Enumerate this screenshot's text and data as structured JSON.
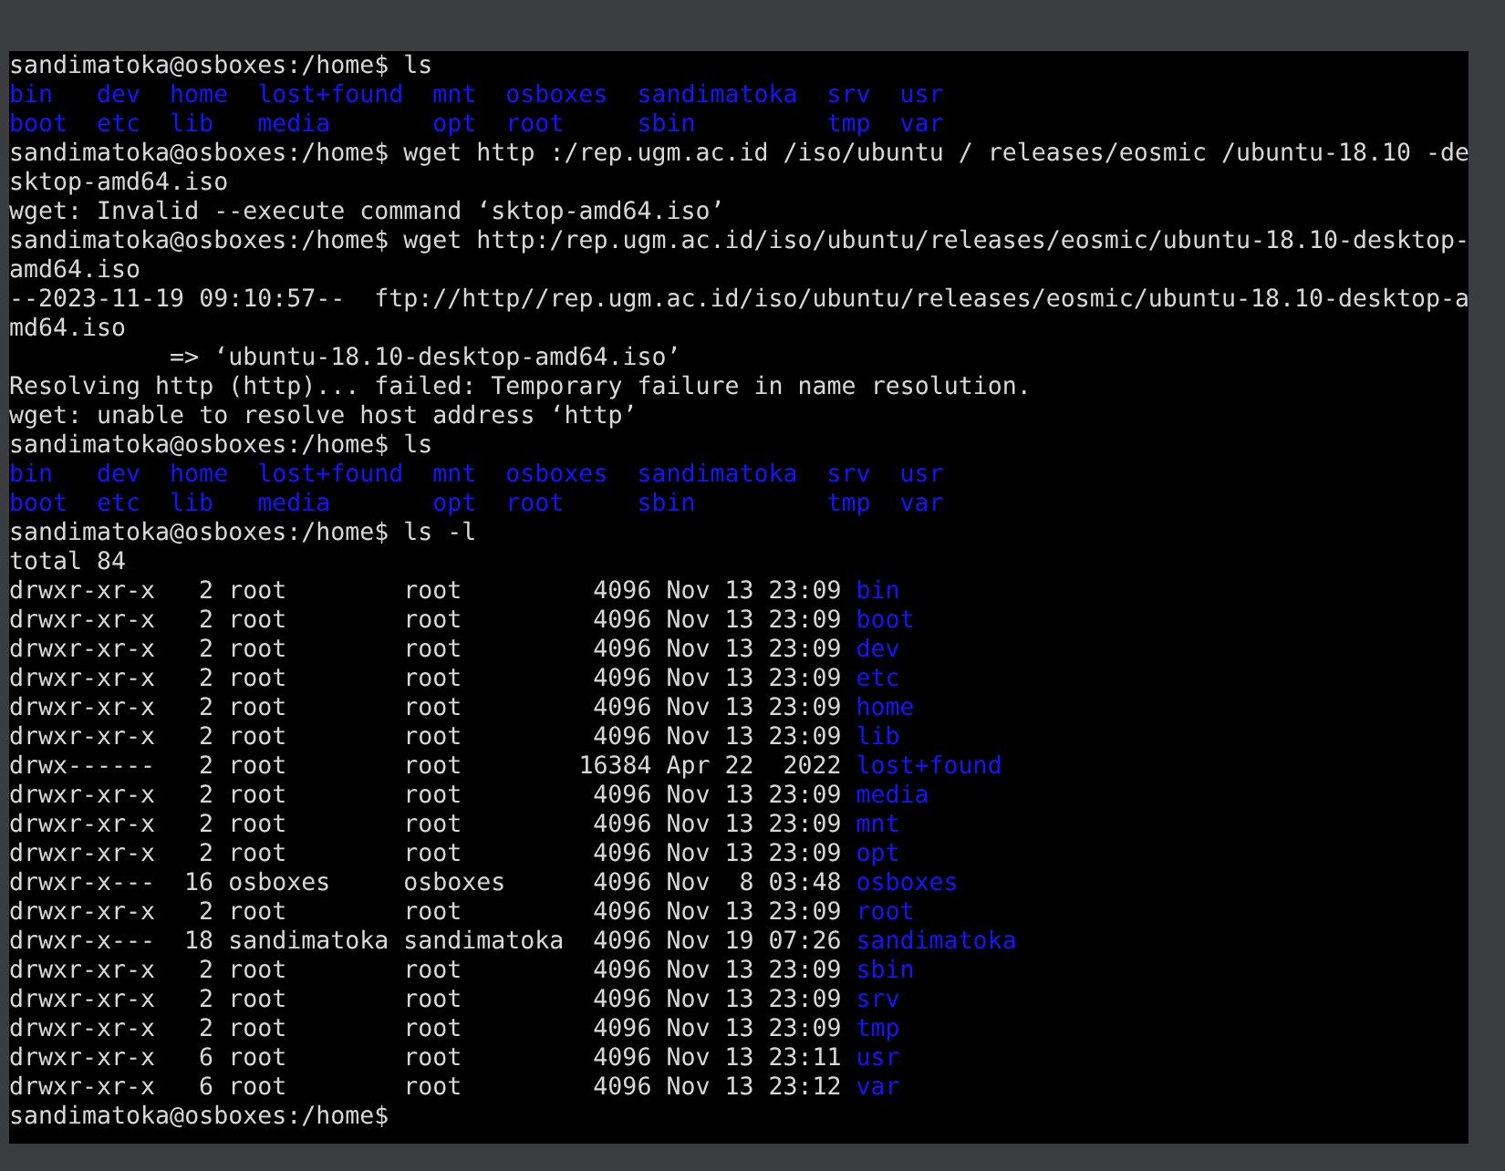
{
  "terminal": {
    "blocks": [
      {
        "kind": "line",
        "text": "sandimatoka@osboxes:/home$ ls"
      },
      {
        "kind": "ls_columns",
        "rows": [
          [
            "bin",
            "dev",
            "home",
            "lost+found",
            "mnt",
            "osboxes",
            "sandimatoka",
            "srv",
            "usr"
          ],
          [
            "boot",
            "etc",
            "lib",
            "media",
            "opt",
            "root",
            "sbin",
            "tmp",
            "var"
          ]
        ]
      },
      {
        "kind": "line",
        "text": "sandimatoka@osboxes:/home$ wget http :/rep.ugm.ac.id /iso/ubuntu / releases/eosmic /ubuntu-18.10 -de"
      },
      {
        "kind": "line",
        "text": "sktop-amd64.iso"
      },
      {
        "kind": "line",
        "text": "wget: Invalid --execute command ‘sktop-amd64.iso’"
      },
      {
        "kind": "line",
        "text": "sandimatoka@osboxes:/home$ wget http:/rep.ugm.ac.id/iso/ubuntu/releases/eosmic/ubuntu-18.10-desktop-"
      },
      {
        "kind": "line",
        "text": "amd64.iso"
      },
      {
        "kind": "line",
        "text": "--2023-11-19 09:10:57--  ftp://http//rep.ugm.ac.id/iso/ubuntu/releases/eosmic/ubuntu-18.10-desktop-a"
      },
      {
        "kind": "line",
        "text": "md64.iso"
      },
      {
        "kind": "continuation",
        "text": "=> ‘ubuntu-18.10-desktop-amd64.iso’"
      },
      {
        "kind": "line",
        "text": "Resolving http (http)... failed: Temporary failure in name resolution."
      },
      {
        "kind": "line",
        "text": "wget: unable to resolve host address ‘http’"
      },
      {
        "kind": "line",
        "text": "sandimatoka@osboxes:/home$ ls"
      },
      {
        "kind": "ls_columns",
        "rows": [
          [
            "bin",
            "dev",
            "home",
            "lost+found",
            "mnt",
            "osboxes",
            "sandimatoka",
            "srv",
            "usr"
          ],
          [
            "boot",
            "etc",
            "lib",
            "media",
            "opt",
            "root",
            "sbin",
            "tmp",
            "var"
          ]
        ]
      },
      {
        "kind": "line",
        "text": "sandimatoka@osboxes:/home$ ls -l"
      },
      {
        "kind": "line",
        "text": "total 84"
      },
      {
        "kind": "ls_long",
        "rows": [
          [
            "drwxr-xr-x",
            "2",
            "root",
            "root",
            "4096",
            "Nov 13 23:09",
            "bin"
          ],
          [
            "drwxr-xr-x",
            "2",
            "root",
            "root",
            "4096",
            "Nov 13 23:09",
            "boot"
          ],
          [
            "drwxr-xr-x",
            "2",
            "root",
            "root",
            "4096",
            "Nov 13 23:09",
            "dev"
          ],
          [
            "drwxr-xr-x",
            "2",
            "root",
            "root",
            "4096",
            "Nov 13 23:09",
            "etc"
          ],
          [
            "drwxr-xr-x",
            "2",
            "root",
            "root",
            "4096",
            "Nov 13 23:09",
            "home"
          ],
          [
            "drwxr-xr-x",
            "2",
            "root",
            "root",
            "4096",
            "Nov 13 23:09",
            "lib"
          ],
          [
            "drwx------",
            "2",
            "root",
            "root",
            "16384",
            "Apr 22  2022",
            "lost+found"
          ],
          [
            "drwxr-xr-x",
            "2",
            "root",
            "root",
            "4096",
            "Nov 13 23:09",
            "media"
          ],
          [
            "drwxr-xr-x",
            "2",
            "root",
            "root",
            "4096",
            "Nov 13 23:09",
            "mnt"
          ],
          [
            "drwxr-xr-x",
            "2",
            "root",
            "root",
            "4096",
            "Nov 13 23:09",
            "opt"
          ],
          [
            "drwxr-x---",
            "16",
            "osboxes",
            "osboxes",
            "4096",
            "Nov  8 03:48",
            "osboxes"
          ],
          [
            "drwxr-xr-x",
            "2",
            "root",
            "root",
            "4096",
            "Nov 13 23:09",
            "root"
          ],
          [
            "drwxr-x---",
            "18",
            "sandimatoka",
            "sandimatoka",
            "4096",
            "Nov 19 07:26",
            "sandimatoka"
          ],
          [
            "drwxr-xr-x",
            "2",
            "root",
            "root",
            "4096",
            "Nov 13 23:09",
            "sbin"
          ],
          [
            "drwxr-xr-x",
            "2",
            "root",
            "root",
            "4096",
            "Nov 13 23:09",
            "srv"
          ],
          [
            "drwxr-xr-x",
            "2",
            "root",
            "root",
            "4096",
            "Nov 13 23:09",
            "tmp"
          ],
          [
            "drwxr-xr-x",
            "6",
            "root",
            "root",
            "4096",
            "Nov 13 23:11",
            "usr"
          ],
          [
            "drwxr-xr-x",
            "6",
            "root",
            "root",
            "4096",
            "Nov 13 23:12",
            "var"
          ]
        ]
      },
      {
        "kind": "line",
        "text": "sandimatoka@osboxes:/home$"
      }
    ]
  }
}
